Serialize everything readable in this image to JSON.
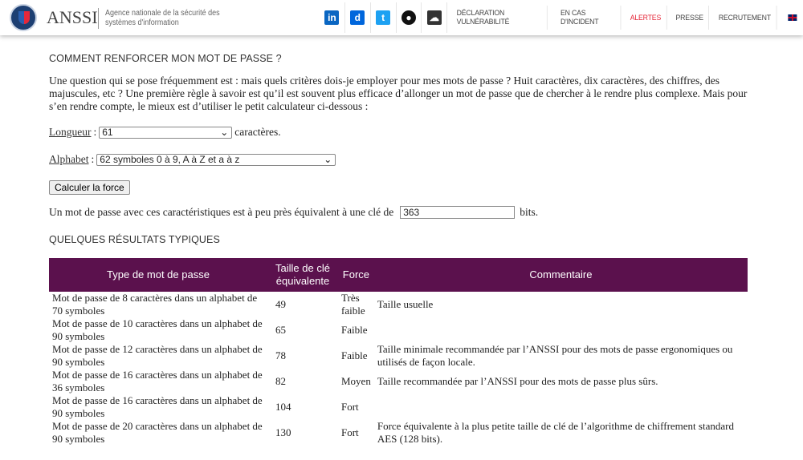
{
  "header": {
    "brand": "ANSSI",
    "tagline": [
      "Agence nationale de la sécurité des",
      "systèmes d'information"
    ],
    "social": [
      {
        "name": "linkedin",
        "label": "in",
        "color": "#0a66c2"
      },
      {
        "name": "dailymotion",
        "label": "d",
        "color": "#0066dc"
      },
      {
        "name": "twitter",
        "label": "t",
        "color": "#1da1f2"
      },
      {
        "name": "github",
        "label": "●",
        "color": "#111111"
      },
      {
        "name": "soundcloud",
        "label": "☁",
        "color": "#333333"
      }
    ],
    "nav": [
      "DÉCLARATION VULNÉRABILITÉ",
      "EN CAS D'INCIDENT",
      "ALERTES",
      "PRESSE",
      "RECRUTEMENT"
    ],
    "alert_color": "#e5283a"
  },
  "main": {
    "title": "COMMENT RENFORCER MON MOT DE PASSE ?",
    "intro": "Une question qui se pose fréquemment est : mais quels critères dois-je employer pour mes mots de passe ? Huit caractères, dix caractères, des chiffres, des majuscules, etc ? Une première règle à savoir est qu’il est souvent plus efficace d’allonger un mot de passe que de chercher à le rendre plus complexe. Mais pour s’en rendre compte, le mieux est d’utiliser le petit calculateur ci-dessous :",
    "length_label": "Longueur",
    "length_value": "61",
    "length_suffix": "caractères.",
    "alphabet_label": "Alphabet",
    "alphabet_value": "62 symboles 0 à 9, A à Z et a à z",
    "calc_button": "Calculer la force",
    "result_prefix": "Un mot de passe avec ces caractéristiques est à peu près équivalent à une clé de",
    "result_value": "363",
    "result_suffix": "bits.",
    "results_title": "QUELQUES RÉSULTATS TYPIQUES",
    "table": {
      "headers": [
        "Type de mot de passe",
        "Taille de clé équivalente",
        "Force",
        "Commentaire"
      ],
      "header_color": "#5b114d",
      "rows": [
        [
          "Mot de passe de 8 caractères dans un alphabet de 70 symboles",
          "49",
          "Très faible",
          "Taille usuelle"
        ],
        [
          "Mot de passe de 10 caractères dans un alphabet de 90 symboles",
          "65",
          "Faible",
          ""
        ],
        [
          "Mot de passe de 12 caractères dans un alphabet de 90 symboles",
          "78",
          "Faible",
          "Taille minimale recommandée par l’ANSSI pour des mots de passe ergonomiques ou utilisés de façon locale."
        ],
        [
          "Mot de passe de 16 caractères dans un alphabet de 36 symboles",
          "82",
          "Moyen",
          "Taille recommandée par l’ANSSI pour des mots de passe plus sûrs."
        ],
        [
          "Mot de passe de 16 caractères dans un alphabet de 90 symboles",
          "104",
          "Fort",
          ""
        ],
        [
          "Mot de passe de 20 caractères dans un alphabet de 90 symboles",
          "130",
          "Fort",
          "Force équivalente à la plus petite taille de clé de l’algorithme de chiffrement standard AES (128 bits)."
        ]
      ]
    }
  }
}
